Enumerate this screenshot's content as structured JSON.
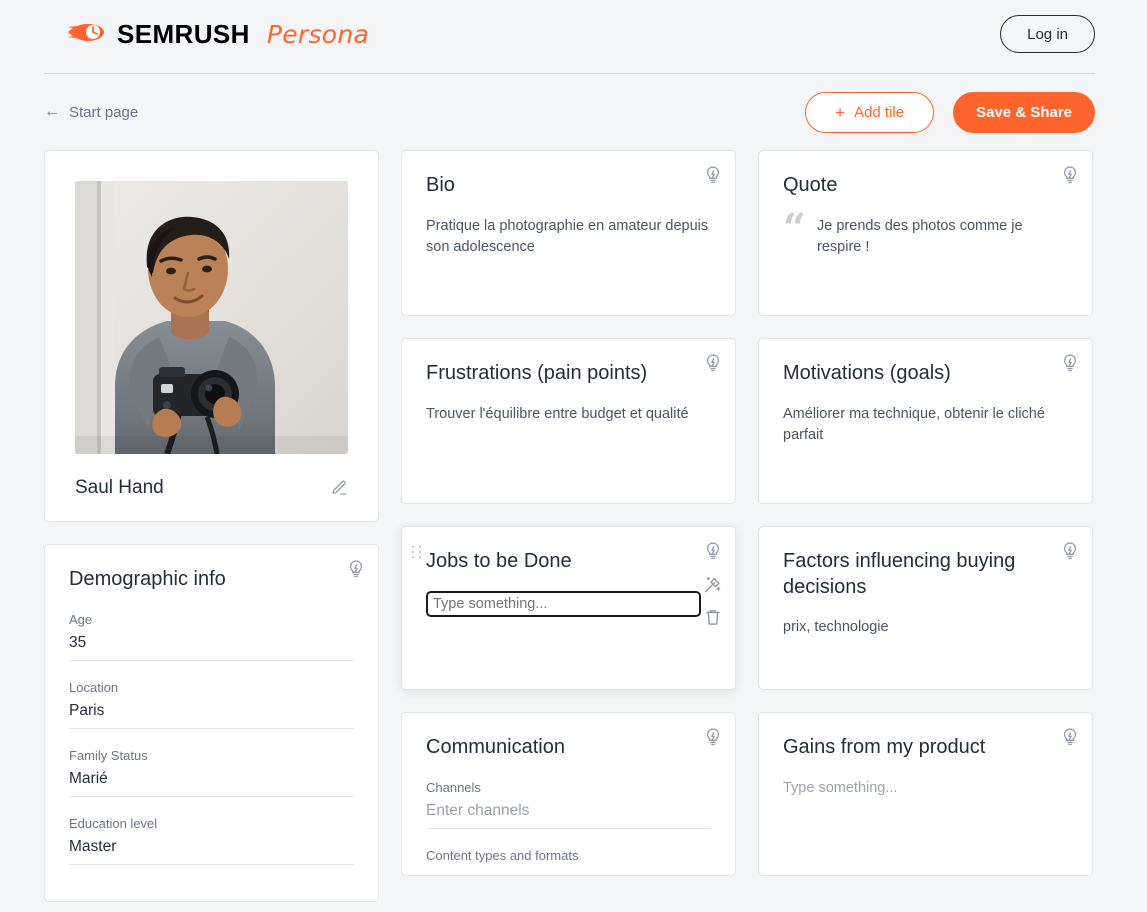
{
  "brand": {
    "word": "SEMRUSH",
    "sub": "Persona",
    "logo_icon": "semrush-comet-icon"
  },
  "header": {
    "login_label": "Log in"
  },
  "toolbar": {
    "back_label": "Start page",
    "back_arrow": "←",
    "add_tile_label": "Add tile",
    "add_tile_plus": "+",
    "save_label": "Save & Share"
  },
  "persona": {
    "name": "Saul Hand",
    "photo_alt": "young man holding a DSLR camera",
    "edit_icon": "pencil-icon"
  },
  "cards": {
    "bio": {
      "title": "Bio",
      "body": "Pratique la photographie en amateur depuis son adolescence"
    },
    "quote": {
      "title": "Quote",
      "quote_mark": "“",
      "body": "Je prends des photos comme je respire !"
    },
    "frustrations": {
      "title": "Frustrations (pain points)",
      "body": "Trouver l'équilibre entre budget et qualité"
    },
    "motivations": {
      "title": "Motivations (goals)",
      "body": "Améliorer ma technique, obtenir le cliché parfait"
    },
    "demographic": {
      "title": "Demographic info",
      "fields": [
        {
          "label": "Age",
          "value": "35"
        },
        {
          "label": "Location",
          "value": "Paris"
        },
        {
          "label": "Family Status",
          "value": "Marié"
        },
        {
          "label": "Education level",
          "value": "Master"
        }
      ]
    },
    "jobs": {
      "title": "Jobs to be Done",
      "input_placeholder": "Type something...",
      "input_value": "",
      "drag_handle_icon": "drag-handle-icon",
      "wand_icon": "magic-wand-icon",
      "trash_icon": "trash-icon"
    },
    "factors": {
      "title": "Factors influencing buying decisions",
      "body": "prix, technologie"
    },
    "communication": {
      "title": "Communication",
      "fields": [
        {
          "label": "Channels",
          "value": "Enter channels",
          "is_placeholder": true
        },
        {
          "label": "Content types and formats",
          "value": "",
          "is_placeholder": true
        }
      ]
    },
    "gains": {
      "title": "Gains from my product",
      "body": "Type something...",
      "is_placeholder": true
    }
  },
  "icons": {
    "hint": "lightbulb-icon"
  },
  "colors": {
    "accent": "#ff642d",
    "page_bg": "#f4f5f7",
    "card_bg": "#ffffff",
    "text": "#242d3c",
    "muted": "#6c7589",
    "placeholder": "#9ba1ad",
    "border": "#e3e5e9"
  }
}
